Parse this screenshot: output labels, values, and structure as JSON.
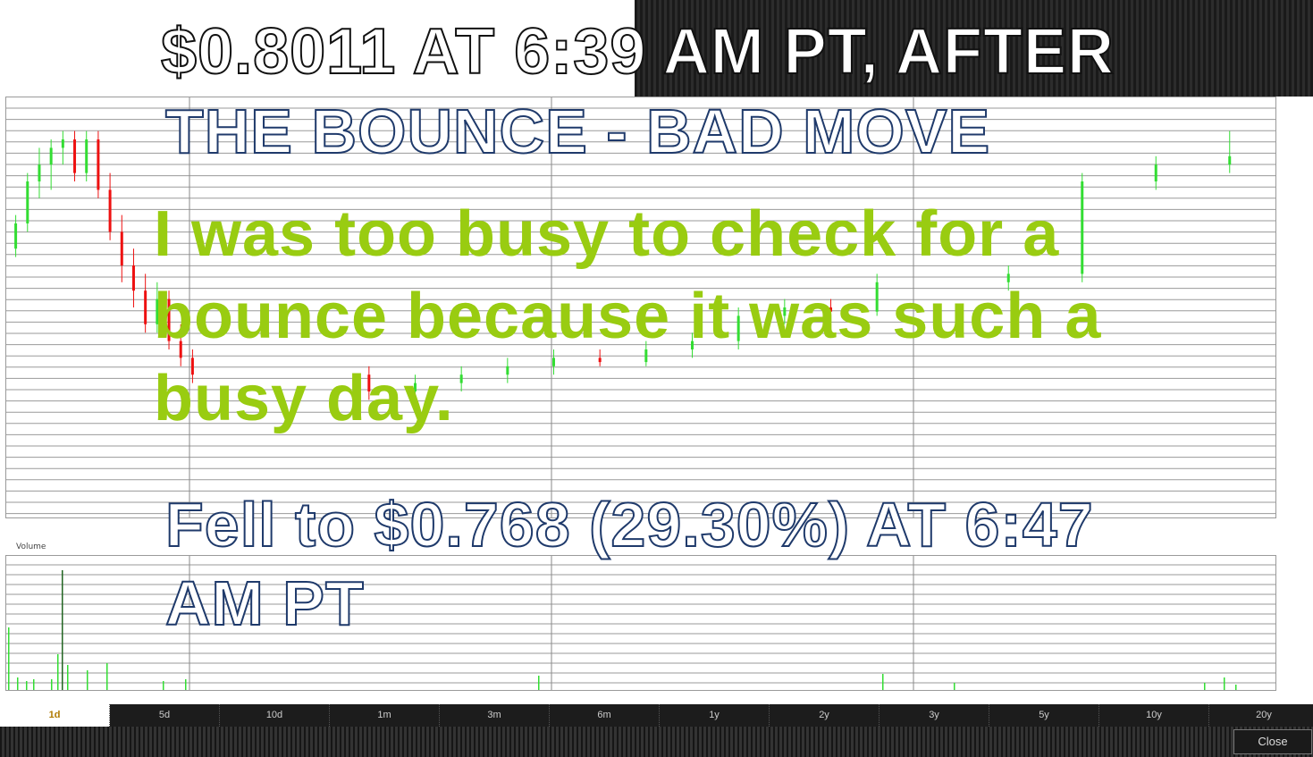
{
  "overlay": {
    "headline_line1": "$0.8011 AT 6:39 AM PT, AFTER",
    "headline_line2": "THE BOUNCE - BAD MOVE",
    "comment_line1": "I was too busy to check for a",
    "comment_line2": "bounce because it was such a",
    "comment_line3": "busy day.",
    "fall_line1": "Fell to $0.768 (29.30%) AT 6:47",
    "fall_line2": "AM PT"
  },
  "volume_label": "Volume",
  "time_ranges": [
    "1d",
    "5d",
    "10d",
    "1m",
    "3m",
    "6m",
    "1y",
    "2y",
    "3y",
    "5y",
    "10y",
    "20y"
  ],
  "active_range": "1d",
  "close_label": "Close",
  "colors": {
    "up": "#33dd33",
    "down": "#ee1111",
    "comment_text": "#99cc11"
  },
  "chart_data": {
    "type": "candlestick",
    "candles": [
      {
        "o": 0.802,
        "h": 0.806,
        "l": 0.801,
        "c": 0.805
      },
      {
        "o": 0.805,
        "h": 0.811,
        "l": 0.804,
        "c": 0.81
      },
      {
        "o": 0.81,
        "h": 0.814,
        "l": 0.808,
        "c": 0.812
      },
      {
        "o": 0.812,
        "h": 0.815,
        "l": 0.809,
        "c": 0.814
      },
      {
        "o": 0.814,
        "h": 0.816,
        "l": 0.812,
        "c": 0.815
      },
      {
        "o": 0.815,
        "h": 0.816,
        "l": 0.81,
        "c": 0.811
      },
      {
        "o": 0.811,
        "h": 0.816,
        "l": 0.81,
        "c": 0.815
      },
      {
        "o": 0.815,
        "h": 0.816,
        "l": 0.808,
        "c": 0.809
      },
      {
        "o": 0.809,
        "h": 0.811,
        "l": 0.803,
        "c": 0.804
      },
      {
        "o": 0.804,
        "h": 0.806,
        "l": 0.798,
        "c": 0.8
      },
      {
        "o": 0.8,
        "h": 0.802,
        "l": 0.795,
        "c": 0.797
      },
      {
        "o": 0.797,
        "h": 0.799,
        "l": 0.792,
        "c": 0.793
      },
      {
        "o": 0.793,
        "h": 0.798,
        "l": 0.792,
        "c": 0.796
      },
      {
        "o": 0.796,
        "h": 0.797,
        "l": 0.79,
        "c": 0.791
      },
      {
        "o": 0.791,
        "h": 0.793,
        "l": 0.788,
        "c": 0.789
      },
      {
        "o": 0.789,
        "h": 0.79,
        "l": 0.786,
        "c": 0.787
      },
      {
        "o": 0.787,
        "h": 0.788,
        "l": 0.784,
        "c": 0.785
      },
      {
        "o": 0.785,
        "h": 0.787,
        "l": 0.783,
        "c": 0.786
      },
      {
        "o": 0.786,
        "h": 0.788,
        "l": 0.785,
        "c": 0.787
      },
      {
        "o": 0.787,
        "h": 0.789,
        "l": 0.786,
        "c": 0.788
      },
      {
        "o": 0.788,
        "h": 0.79,
        "l": 0.787,
        "c": 0.789
      },
      {
        "o": 0.789,
        "h": 0.79,
        "l": 0.788,
        "c": 0.7885
      },
      {
        "o": 0.7885,
        "h": 0.791,
        "l": 0.788,
        "c": 0.79
      },
      {
        "o": 0.79,
        "h": 0.792,
        "l": 0.789,
        "c": 0.791
      },
      {
        "o": 0.791,
        "h": 0.795,
        "l": 0.79,
        "c": 0.794
      },
      {
        "o": 0.794,
        "h": 0.796,
        "l": 0.793,
        "c": 0.795
      },
      {
        "o": 0.795,
        "h": 0.796,
        "l": 0.794,
        "c": 0.7945
      },
      {
        "o": 0.7945,
        "h": 0.799,
        "l": 0.794,
        "c": 0.798
      },
      {
        "o": 0.798,
        "h": 0.8,
        "l": 0.797,
        "c": 0.799
      },
      {
        "o": 0.799,
        "h": 0.811,
        "l": 0.798,
        "c": 0.81
      },
      {
        "o": 0.81,
        "h": 0.813,
        "l": 0.809,
        "c": 0.812
      },
      {
        "o": 0.812,
        "h": 0.816,
        "l": 0.811,
        "c": 0.813
      }
    ]
  }
}
